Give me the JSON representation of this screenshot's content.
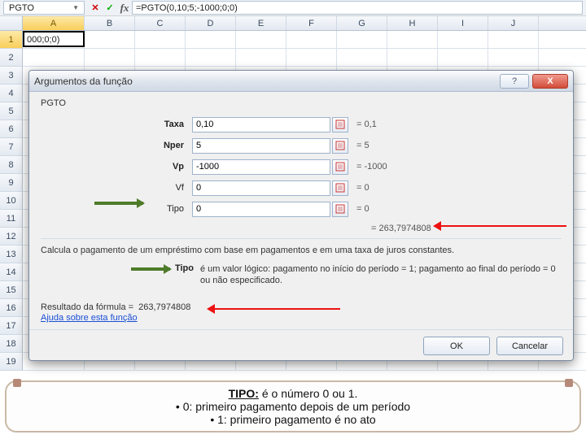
{
  "formulaBar": {
    "nameBox": "PGTO",
    "formula": "=PGTO(0,10;5;-1000;0;0)"
  },
  "columns": [
    "A",
    "B",
    "C",
    "D",
    "E",
    "F",
    "G",
    "H",
    "I",
    "J"
  ],
  "rows": [
    "1",
    "2",
    "3",
    "4",
    "5",
    "6",
    "7",
    "8",
    "9",
    "10",
    "11",
    "12",
    "13",
    "14",
    "15",
    "16",
    "17",
    "18",
    "19"
  ],
  "cellA1": "000;0;0)",
  "dialog": {
    "title": "Argumentos da função",
    "functionName": "PGTO",
    "args": [
      {
        "label": "Taxa",
        "bold": true,
        "value": "0,10",
        "result": "0,1"
      },
      {
        "label": "Nper",
        "bold": true,
        "value": "5",
        "result": "5"
      },
      {
        "label": "Vp",
        "bold": true,
        "value": "-1000",
        "result": "-1000"
      },
      {
        "label": "Vf",
        "bold": false,
        "value": "0",
        "result": "0"
      },
      {
        "label": "Tipo",
        "bold": false,
        "value": "0",
        "result": "0"
      }
    ],
    "computed": "263,7974808",
    "description": "Calcula o pagamento de um empréstimo com base em pagamentos e em uma taxa de juros constantes.",
    "paramHelpLabel": "Tipo",
    "paramHelpText": "é um valor lógico: pagamento no início do período = 1; pagamento ao final do período = 0 ou não especificado.",
    "formulaResultLabel": "Resultado da fórmula =",
    "formulaResultValue": "263,7974808",
    "helpLink": "Ajuda sobre esta função",
    "ok": "OK",
    "cancel": "Cancelar"
  },
  "note": {
    "line1a": "TIPO:",
    "line1b": " é o número 0 ou 1.",
    "line2": "• 0: primeiro pagamento depois de um período",
    "line3": "• 1: primeiro pagamento é no ato"
  }
}
